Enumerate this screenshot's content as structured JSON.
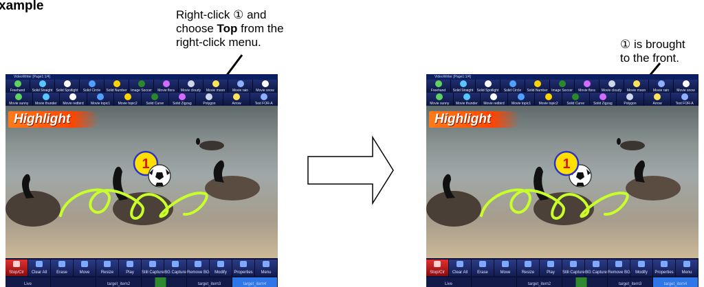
{
  "heading": "xample",
  "callout_left": {
    "line1": "Right-click ① and",
    "line2_pre": "choose ",
    "line2_bold": "Top",
    "line2_post": " from the",
    "line3": "right-click menu."
  },
  "callout_right": {
    "line1": "① is brought",
    "line2": "to the front."
  },
  "screen": {
    "title": "VideoWriter [Page1:1/4]",
    "toolbar_row1": [
      "Freehand",
      "Solid Straight",
      "Solid Spotlight",
      "Solid Circle",
      "Solid Number",
      "Image Soccer",
      "Movie flora",
      "Movie cloudy",
      "Movie moon",
      "Movie rain",
      "Movie snow"
    ],
    "toolbar_row2": [
      "Movie sunny",
      "Movie thunder",
      "Movie redbird",
      "Movie topic1",
      "Movie topic2",
      "Solid Curve",
      "Solid Zigzag",
      "Polygon",
      "Arrow",
      "Text FOR-A"
    ],
    "overlay_text": "Highlight",
    "number_badge": "1",
    "buttons": [
      "Stop/Clr",
      "Clear All",
      "Erase",
      "Move",
      "Resize",
      "Play",
      "Still Capture",
      "BG Capture",
      "Remove BG",
      "Modify",
      "Properties",
      "Menu"
    ],
    "pages": [
      "Live",
      "",
      "target_item2",
      "",
      "target_item3",
      "target_item4"
    ],
    "colors": {
      "title_bar": "#0a1e60",
      "toolbar": "#1a2766",
      "accent_red": "#e23030",
      "selected_page": "#2d77e8",
      "squiggle": "#c8ff2a",
      "badge": "#ffe000",
      "highlight": "#ff5a00"
    }
  },
  "arrow_icon": "right-arrow-icon"
}
